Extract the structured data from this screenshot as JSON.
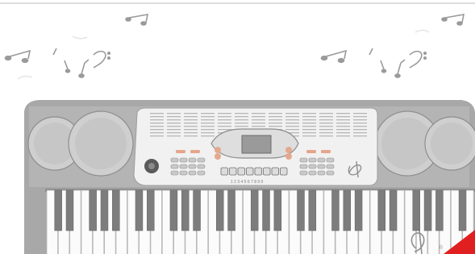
{
  "scene": {
    "subject": "electronic-keyboard",
    "palette": {
      "background": "#ffffff",
      "body": "#a9a9a9",
      "body_dark": "#8e8e8e",
      "panel": "#f1f1f1",
      "white_key": "#fbfbfb",
      "black_key": "#7d7d7d",
      "note": "#9a9a9a",
      "accent": "#e02020"
    },
    "icons": [
      "eighth-note-icon",
      "beamed-notes-icon",
      "bass-clef-icon",
      "treble-clef-icon"
    ],
    "keyboard": {
      "white_key_count": 37,
      "number_strip": "1 2 3 4 5 6 7 8 9 0",
      "corner_mark": "®"
    }
  }
}
